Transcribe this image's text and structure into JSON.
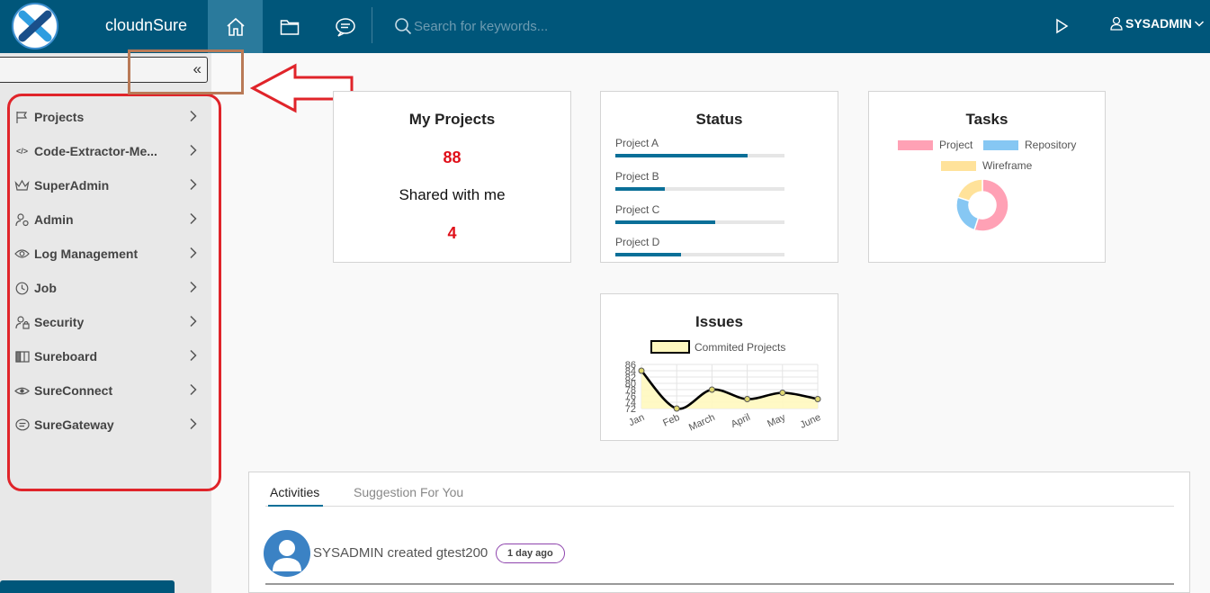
{
  "header": {
    "app_name": "cloudnSure",
    "search_placeholder": "Search for keywords...",
    "user": "SYSADMIN",
    "icons": [
      "home-icon",
      "folder-icon",
      "chat-icon",
      "search-icon",
      "play-icon",
      "user-icon",
      "chevron-down-icon"
    ],
    "colors": {
      "bar": "#00567a",
      "active_tab": "#2a7a9c"
    }
  },
  "sidebar": {
    "items": [
      {
        "label": "Projects",
        "icon": "flag-icon"
      },
      {
        "label": "Code-Extractor-Me...",
        "icon": "code-icon"
      },
      {
        "label": "SuperAdmin",
        "icon": "crown-icon"
      },
      {
        "label": "Admin",
        "icon": "user-gear-icon"
      },
      {
        "label": "Log Management",
        "icon": "eye-icon"
      },
      {
        "label": "Job",
        "icon": "clock-icon"
      },
      {
        "label": "Security",
        "icon": "user-lock-icon"
      },
      {
        "label": "Sureboard",
        "icon": "board-icon"
      },
      {
        "label": "SureConnect",
        "icon": "connect-icon"
      },
      {
        "label": "SureGateway",
        "icon": "gateway-icon"
      }
    ],
    "collapse_glyph": "«"
  },
  "cards": {
    "my_projects": {
      "title": "My Projects",
      "count": "88",
      "shared_title": "Shared with me",
      "shared_count": "4"
    },
    "status": {
      "title": "Status",
      "projects": [
        {
          "label": "Project A",
          "progress": 0.78
        },
        {
          "label": "Project B",
          "progress": 0.29
        },
        {
          "label": "Project C",
          "progress": 0.59
        },
        {
          "label": "Project D",
          "progress": 0.39
        }
      ]
    },
    "tasks": {
      "title": "Tasks"
    },
    "issues": {
      "title": "Issues"
    }
  },
  "chart_data": [
    {
      "type": "pie",
      "title": "Tasks",
      "labels": [
        "Project",
        "Repository",
        "Wireframe"
      ],
      "values": [
        55,
        25,
        20
      ],
      "colors": [
        "#ffa1b5",
        "#86c7f3",
        "#ffe29a"
      ],
      "legend": "top"
    },
    {
      "type": "area",
      "title": "Issues",
      "categories": [
        "Jan",
        "Feb",
        "March",
        "April",
        "May",
        "June"
      ],
      "series": [
        {
          "name": "Commited Projects",
          "values": [
            84,
            72,
            78,
            75,
            77,
            75
          ]
        }
      ],
      "yticks": [
        "72",
        "74",
        "76",
        "78",
        "80",
        "82",
        "84",
        "86"
      ],
      "ylim": [
        72,
        86
      ],
      "grid": true,
      "legend": "top",
      "colors": {
        "fill": "#fff8bf",
        "line": "#000000",
        "point": "#e0d870"
      }
    }
  ],
  "activities": {
    "tabs": [
      "Activities",
      "Suggestion For You"
    ],
    "items": [
      {
        "text": "SYSADMIN created gtest200",
        "badge": "1 day ago"
      }
    ]
  }
}
